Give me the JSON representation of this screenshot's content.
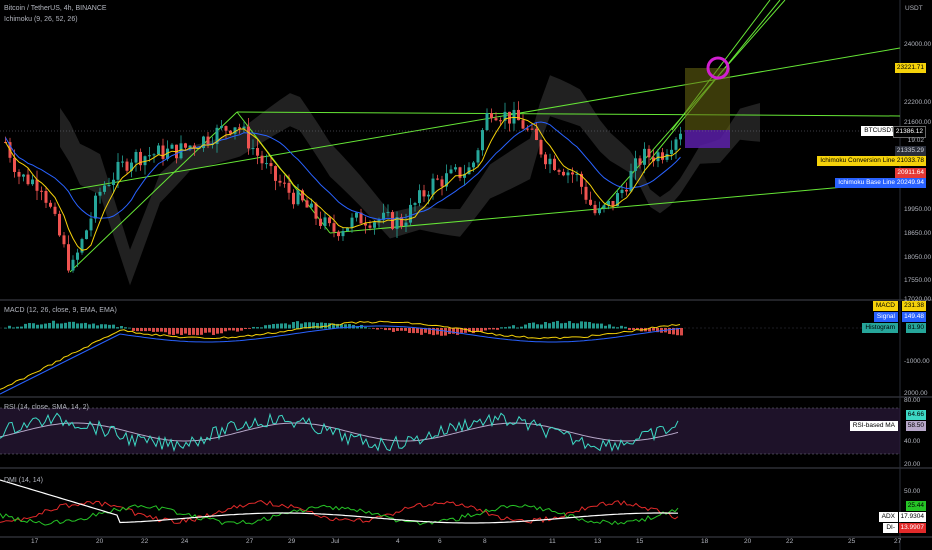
{
  "header": {
    "symbol_line": "Bitcoin / TetherUS, 4h, BINANCE",
    "ichimoku_line": "Ichimoku (9, 26, 52, 26)",
    "macd_line": "MACD (12, 26, close, 9, EMA, EMA)",
    "rsi_line": "RSI (14, close, SMA, 14, 2)",
    "dmi_line": "DMI (14, 14)"
  },
  "price_axis": {
    "currency": "USDT",
    "ticks": [
      "24000.00",
      "22200.00",
      "21600.00",
      "19950.00",
      "18650.00",
      "18050.00",
      "17550.00",
      "17020.00"
    ]
  },
  "price_tags": {
    "target": "23221.71",
    "btc_label": "BTCUSDT",
    "btc_price": "21386.12",
    "btc_time": "19:02",
    "p2": "21335.29",
    "conv_label": "Ichimoku Conversion Line",
    "conv_value": "21033.78",
    "p3": "20911.64",
    "base_label": "Ichimoku Base Line",
    "base_value": "20249.94"
  },
  "macd_axis": {
    "ticks": [
      "-1000.00",
      "2000.00"
    ],
    "macd_label": "MACD",
    "macd_value": "231.38",
    "signal_label": "Signal",
    "signal_value": "149.48",
    "hist_label": "Histogram",
    "hist_value": "81.90"
  },
  "rsi_axis": {
    "ticks": [
      "80.00",
      "40.00",
      "20.00"
    ],
    "rsi_value": "64.66",
    "ma_label": "RSI-based MA",
    "ma_value": "58.50"
  },
  "dmi_axis": {
    "ticks": [
      "50.00"
    ],
    "di_plus_value": "25.44",
    "adx_label": "ADX",
    "adx_value": "17.9304",
    "di_minus_label": "DI-",
    "di_minus_value": "13.9907"
  },
  "time_axis": {
    "labels": [
      "17",
      "20",
      "22",
      "24",
      "27",
      "29",
      "Jul",
      "4",
      "6",
      "8",
      "11",
      "13",
      "15",
      "18",
      "20",
      "22",
      "25",
      "27"
    ]
  },
  "colors": {
    "up": "#26a69a",
    "down": "#ef5350",
    "conversion": "#f5d20a",
    "base": "#2962ff",
    "channel": "#66e636",
    "macd": "#f5d20a",
    "signal": "#2962ff",
    "rsi": "#3dd9c5",
    "rsi_ma": "#b7a8c9",
    "adx": "#ffffff",
    "di_plus": "#26c426",
    "di_minus": "#e22a2a",
    "target_circle": "#d11fd0"
  },
  "chart_data": {
    "type": "candlestick",
    "symbol": "BTCUSDT",
    "timeframe": "4h",
    "exchange": "BINANCE",
    "price_range": [
      16950,
      24600
    ],
    "x_labels": [
      "17",
      "20",
      "22",
      "24",
      "27",
      "29",
      "Jul",
      "4",
      "6",
      "8",
      "11",
      "13",
      "15",
      "18",
      "20",
      "22",
      "25",
      "27"
    ],
    "key_closes": [
      {
        "period": "start",
        "price": 21000
      },
      {
        "period": "18 low",
        "price": 17600
      },
      {
        "period": "26 high",
        "price": 21500
      },
      {
        "period": "30 low",
        "price": 18650
      },
      {
        "period": "8 high",
        "price": 22000
      },
      {
        "period": "14 low",
        "price": 19000
      },
      {
        "period": "last",
        "price": 21386.12
      }
    ],
    "indicators": {
      "ichimoku_conversion": 21033.78,
      "ichimoku_base": 20249.94,
      "macd": 231.38,
      "signal": 149.48,
      "histogram": 81.9,
      "rsi": 64.66,
      "rsi_ma": 58.5,
      "di_plus": 25.44,
      "adx": 17.9304,
      "di_minus": 13.9907
    },
    "target_price": 23221.71
  }
}
